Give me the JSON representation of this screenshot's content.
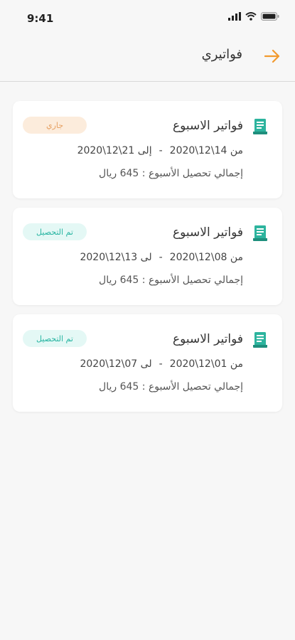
{
  "status_bar": {
    "time": "9:41"
  },
  "header": {
    "title": "فواتيري"
  },
  "colors": {
    "accent": "#f29a2e",
    "teal": "#2db49e"
  },
  "invoices": [
    {
      "title": "فواتير الاسبوع",
      "from": "من 14\\12\\2020",
      "separator": "-",
      "to": "إلى 21\\12\\2020",
      "total": "إجمالي تحصيل الأسبوع : 645 ريال",
      "status": "جاري"
    },
    {
      "title": "فواتير الاسبوع",
      "from": "من 08\\12\\2020",
      "separator": "-",
      "to": "لى 13\\12\\2020",
      "total": "إجمالي تحصيل الأسبوع : 645 ريال",
      "status": "تم التحصيل"
    },
    {
      "title": "فواتير الاسبوع",
      "from": "من 01\\12\\2020",
      "separator": "-",
      "to": "لى 07\\12\\2020",
      "total": "إجمالي تحصيل الأسبوع : 645 ريال",
      "status": "تم التحصيل"
    }
  ]
}
